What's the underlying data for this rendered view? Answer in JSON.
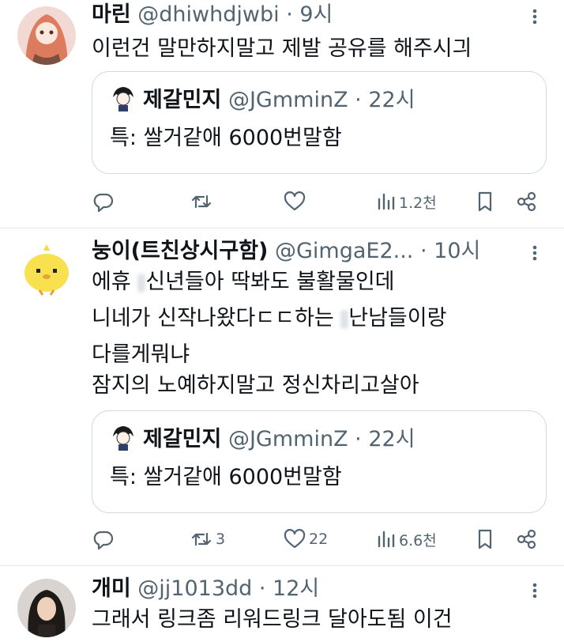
{
  "tweets": [
    {
      "name": "마린",
      "handle": "@dhiwhdjwbi",
      "time": "· 9시",
      "lines": [
        "이런건 말만하지말고 제발 공유를 해주시긔"
      ],
      "quote": {
        "name": "제갈민지",
        "handle": "@JGmminZ",
        "time": "· 22시",
        "text": "특: 쌀거같애 6000번말함"
      },
      "stats": {
        "retweets": "",
        "likes": "",
        "views": "1.2천"
      }
    },
    {
      "name": "눙이(트친상시구함)",
      "handle": "@GimgaE2...",
      "time": "· 10시",
      "lines_a": [
        "에휴 ",
        "신년들아 딱봐도 불활물인데"
      ],
      "lines_b": [
        "니네가 신작나왔다ㄷㄷ하는 ",
        "난남들이랑"
      ],
      "lines": [
        "다를게뭐냐",
        "잠지의 노예하지말고 정신차리고살아"
      ],
      "quote": {
        "name": "제갈민지",
        "handle": "@JGmminZ",
        "time": "· 22시",
        "text": "특: 쌀거같애 6000번말함"
      },
      "stats": {
        "retweets": "3",
        "likes": "22",
        "views": "6.6천"
      }
    },
    {
      "name": "개미",
      "handle": "@jj1013dd",
      "time": "· 12시",
      "lines": [
        "그래서 링크좀 리워드링크 달아도됨 이건"
      ]
    }
  ],
  "colors": {
    "text": "#0f1419",
    "secondary": "#536471",
    "border": "#cfd9de"
  }
}
